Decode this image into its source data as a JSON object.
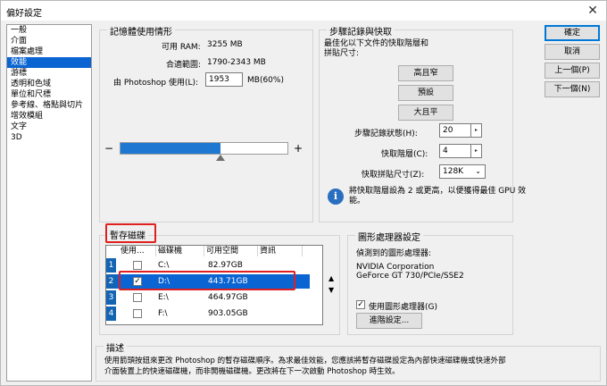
{
  "window": {
    "title": "偏好設定",
    "close_glyph": "✕"
  },
  "sidebar": {
    "items": [
      {
        "label": "一般",
        "selected": false
      },
      {
        "label": "介面",
        "selected": false
      },
      {
        "label": "檔案處理",
        "selected": false
      },
      {
        "label": "效能",
        "selected": true
      },
      {
        "label": "游標",
        "selected": false
      },
      {
        "label": "透明和色域",
        "selected": false
      },
      {
        "label": "單位和尺標",
        "selected": false
      },
      {
        "label": "參考線、格點與切片",
        "selected": false
      },
      {
        "label": "增效模組",
        "selected": false
      },
      {
        "label": "文字",
        "selected": false
      },
      {
        "label": "3D",
        "selected": false
      }
    ]
  },
  "memory": {
    "legend": "記憶體使用情形",
    "ram_label": "可用 RAM:",
    "ram_value": "3255 MB",
    "range_label": "合適範圍:",
    "range_value": "1790-2343 MB",
    "use_label": "由 Photoshop 使用(L):",
    "use_value": "1953",
    "use_unit": "MB(60%)",
    "slider_minus": "−",
    "slider_plus": "+",
    "slider_fraction": 0.6
  },
  "history": {
    "legend": "步驟記錄與快取",
    "optimize_text": "最佳化以下文件的快取階層和\n拼貼尺寸:",
    "btn_tall": "高且窄",
    "btn_default": "預設",
    "btn_big": "大且平",
    "states_label": "步驟記錄狀態(H):",
    "states_value": "20",
    "levels_label": "快取階層(C):",
    "levels_value": "4",
    "tile_label": "快取拼貼尺寸(Z):",
    "tile_value": "128K",
    "info_text": "將快取階層設為 2 或更高，以便獲得最佳 GPU 效\n能。",
    "spin_glyph": "▸",
    "dropdown_glyph": "⌄"
  },
  "scratch": {
    "legend": "暫存磁碟",
    "columns": [
      "使用...",
      "磁碟機",
      "可用空間",
      "資訊"
    ],
    "rows": [
      {
        "num": "1",
        "checked": false,
        "drive": "C:\\",
        "free": "82.97GB",
        "info": "",
        "selected": false
      },
      {
        "num": "2",
        "checked": true,
        "drive": "D:\\",
        "free": "443.71GB",
        "info": "",
        "selected": true
      },
      {
        "num": "3",
        "checked": false,
        "drive": "E:\\",
        "free": "464.97GB",
        "info": "",
        "selected": false
      },
      {
        "num": "4",
        "checked": false,
        "drive": "F:\\",
        "free": "903.05GB",
        "info": "",
        "selected": false
      }
    ],
    "up_glyph": "▲",
    "down_glyph": "▼",
    "check_glyph": "✓"
  },
  "gpu": {
    "legend": "圖形處理器設定",
    "detected_label": "偵測到的圖形處理器:",
    "vendor": "NVIDIA Corporation",
    "model": "GeForce GT 730/PCIe/SSE2",
    "use_gpu_label": "使用圖形處理器(G)",
    "use_gpu_checked": true,
    "advanced_btn": "進階設定..."
  },
  "description": {
    "legend": "描述",
    "text_line1": "使用箭頭按鈕來更改 Photoshop 的暫存磁碟順序。為求最佳效能，您應該將暫存磁碟設定為內部快速磁碟機或快速外部",
    "text_line2": "介面裝置上的快速磁碟機，而非開機磁碟機。更改將在下一次啟動 Photoshop 時生效。"
  },
  "actions": {
    "ok": "確定",
    "cancel": "取消",
    "prev": "上一個(P)",
    "next": "下一個(N)"
  },
  "colors": {
    "selection": "#0a64d2",
    "highlight": "#e02020",
    "slider": "#1e78d2"
  }
}
